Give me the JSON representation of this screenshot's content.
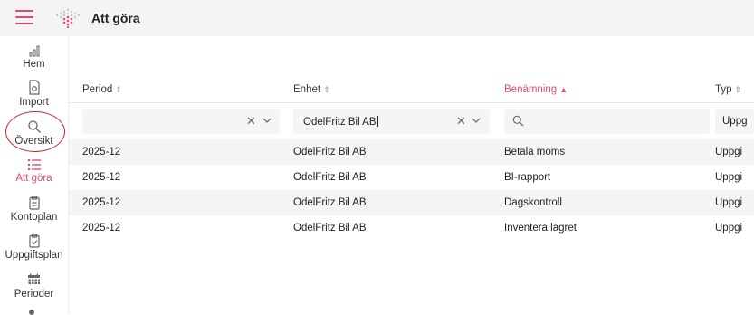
{
  "header": {
    "title": "Att göra",
    "accent": "#e0497a"
  },
  "sidebar": {
    "items": [
      {
        "label": "Hem",
        "icon": "bar-chart-icon"
      },
      {
        "label": "Import",
        "icon": "document-icon"
      },
      {
        "label": "Översikt",
        "icon": "search-icon"
      },
      {
        "label": "Att göra",
        "icon": "list-icon",
        "active": true
      },
      {
        "label": "Kontoplan",
        "icon": "clipboard-icon"
      },
      {
        "label": "Uppgiftsplan",
        "icon": "clipboard-check-icon"
      },
      {
        "label": "Perioder",
        "icon": "calendar-icon"
      }
    ]
  },
  "table": {
    "columns": [
      {
        "label": "Period",
        "sort": "⇕"
      },
      {
        "label": "Enhet",
        "sort": "⇕"
      },
      {
        "label": "Benämning",
        "sort": "▲"
      },
      {
        "label": "Typ",
        "sort": "⇕"
      }
    ],
    "filters": {
      "period": {
        "value": ""
      },
      "enhet": {
        "value": "OdelFritz Bil AB"
      },
      "benamning": {
        "value": ""
      },
      "typ": {
        "value": "Uppg"
      }
    },
    "rows": [
      {
        "period": "2025-12",
        "enhet": "OdelFritz Bil AB",
        "benamning": "Betala moms",
        "typ": "Uppgi"
      },
      {
        "period": "2025-12",
        "enhet": "OdelFritz Bil AB",
        "benamning": "BI-rapport",
        "typ": "Uppgi"
      },
      {
        "period": "2025-12",
        "enhet": "OdelFritz Bil AB",
        "benamning": "Dagskontroll",
        "typ": "Uppgi"
      },
      {
        "period": "2025-12",
        "enhet": "OdelFritz Bil AB",
        "benamning": "Inventera lagret",
        "typ": "Uppgi"
      }
    ]
  }
}
